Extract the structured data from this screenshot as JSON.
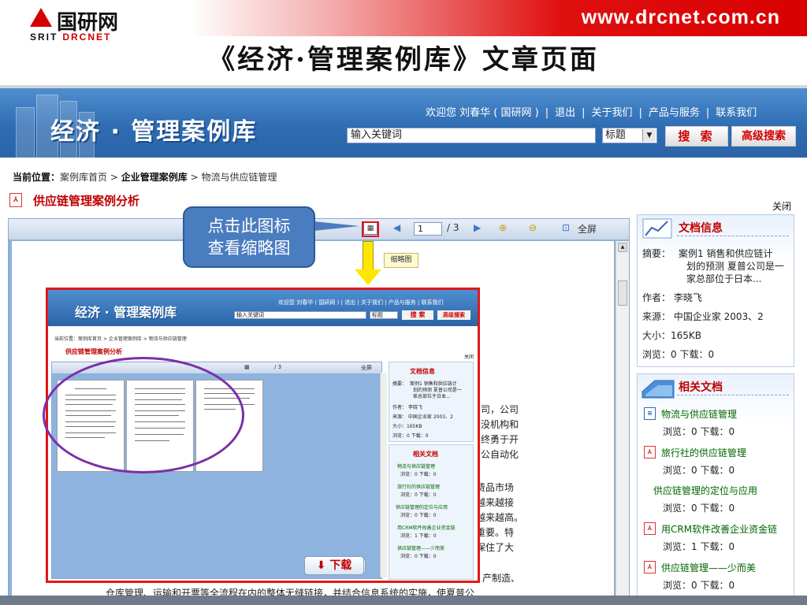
{
  "slide": {
    "site_url": "www.drcnet.com.cn",
    "logo_cn": "国研网",
    "logo_en_prefix": "SRIT",
    "logo_en_name": "DRCNET",
    "title": "《经济·管理案例库》文章页面"
  },
  "app": {
    "brand": "经济 · 管理案例库",
    "topnav": {
      "welcome": "欢迎您 刘春华 ( 国研网 )",
      "logout": "退出",
      "about": "关于我们",
      "products": "产品与服务",
      "contact": "联系我们"
    },
    "search": {
      "value": "输入关键词",
      "field": "标题",
      "search_label": "搜 索",
      "advanced_label": "高级搜索"
    },
    "breadcrumb": {
      "label": "当前位置：",
      "home": "案例库首页",
      "level2": "企业管理案例库",
      "level3": "物流与供应链管理",
      "sep": ">"
    },
    "doc_title": "供应链管理案例分析",
    "close": "关闭",
    "viewer": {
      "page_current": "1",
      "page_total": "/ 3",
      "fullscreen": "全屏",
      "download": "下载",
      "thumbnail_tip": "缩略图"
    },
    "doc_info": {
      "title": "文档信息",
      "summary_label": "摘要：",
      "summary_lines": [
        "案例1 销售和供应链计",
        "划的预测 夏普公司是一",
        "家总部位于日本..."
      ],
      "author": "作者： 李晓飞",
      "source": "来源： 中国企业家 2003、2",
      "size": "大小：165KB",
      "stats": "浏览：0    下载：0"
    },
    "related": {
      "title": "相关文档",
      "items": [
        {
          "title": "物流与供应链管理",
          "stats": "浏览：0    下载：0"
        },
        {
          "title": "旅行社的供应链管理",
          "stats": "浏览：0    下载：0"
        },
        {
          "title": "供应链管理的定位与应用",
          "stats": "浏览：0    下载：0"
        },
        {
          "title": "用CRM软件改善企业资金链",
          "stats": "浏览：1    下载：0"
        },
        {
          "title": "供应链管理——少而美",
          "stats": "浏览：0    下载：0"
        }
      ]
    },
    "body_text": [
      "司，公司",
      "没机构和",
      "终勇于开",
      "公自动化",
      "费品市场",
      "越来越接",
      "越来越高。",
      "重要。特",
      "保住了大",
      "产制造、",
      "仓库管理、运输和开票等全流程在内的整体无缝链接，并结合信息系统的实施，使夏普公"
    ]
  },
  "annotation": {
    "callout_line1": "点击此图标",
    "callout_line2": "查看缩略图"
  },
  "colors": {
    "banner_blue": "#2f6cb2",
    "accent_red": "#c00000",
    "link_green": "#006600",
    "callout_blue": "#4a7cc0",
    "ellipse_purple": "#7b2fa8"
  }
}
